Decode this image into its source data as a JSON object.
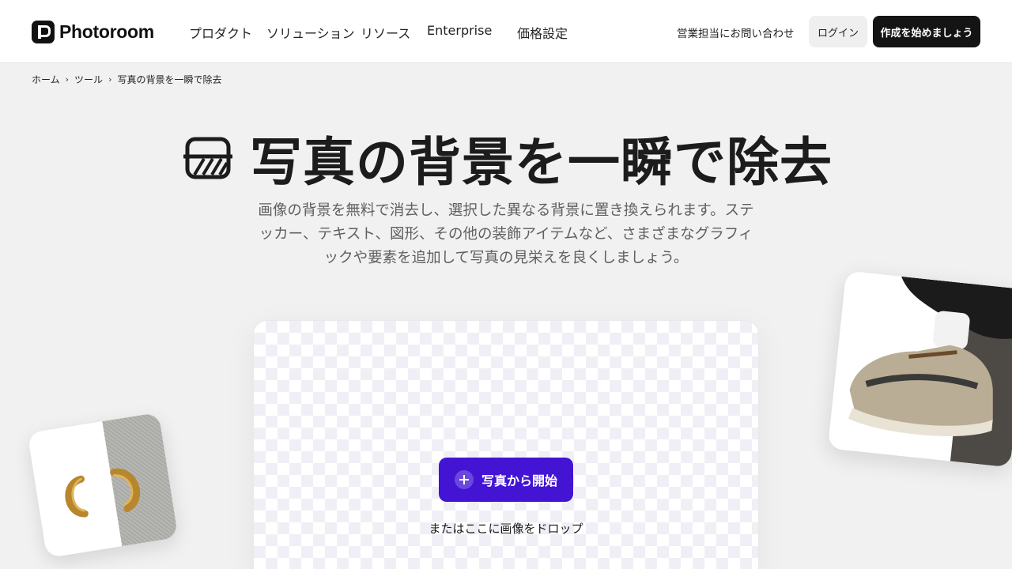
{
  "brand": {
    "name": "Photoroom"
  },
  "nav": {
    "items": [
      "プロダクト",
      "ソリューション",
      "リソース",
      "Enterprise",
      "価格設定"
    ]
  },
  "header_actions": {
    "sales": "営業担当にお問い合わせ",
    "login": "ログイン",
    "start": "作成を始めましょう"
  },
  "breadcrumb": [
    "ホーム",
    "ツール",
    "写真の背景を一瞬で除去"
  ],
  "hero": {
    "title": "写真の背景を一瞬で除去",
    "subtitle": "画像の背景を無料で消去し、選択した異なる背景に置き換えられます。ステッカー、テキスト、図形、その他の装飾アイテムなど、さまざまなグラフィックや要素を追加して写真の見栄えを良くしましょう。"
  },
  "upload": {
    "button_label": "写真から開始",
    "drop_text": "またはここに画像をドロップ"
  },
  "colors": {
    "accent": "#4314d4",
    "dark_button": "#141414",
    "background": "#f1f1f1"
  }
}
